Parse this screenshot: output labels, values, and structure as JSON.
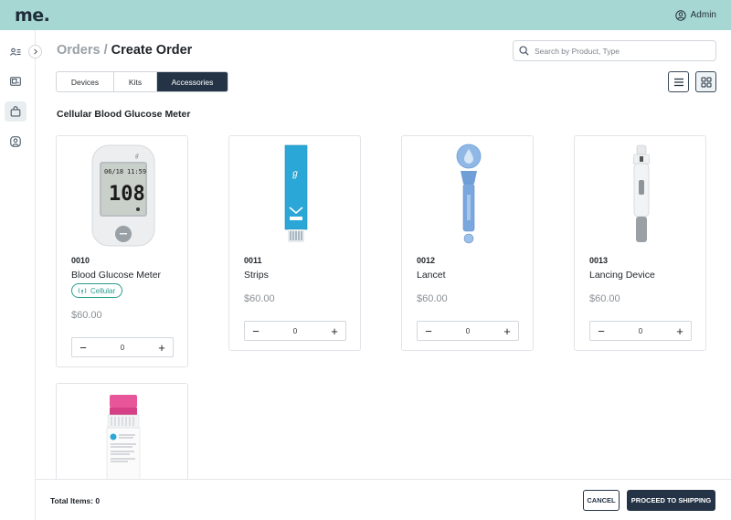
{
  "app": {
    "logo": "me.",
    "user_label": "Admin"
  },
  "sidebar": {
    "items": [
      {
        "icon": "users-list-icon"
      },
      {
        "icon": "device-icon"
      },
      {
        "icon": "shopping-bag-icon",
        "active": true
      },
      {
        "icon": "user-badge-icon"
      }
    ]
  },
  "page": {
    "breadcrumb": "Orders /",
    "title": "Create Order"
  },
  "search": {
    "placeholder": "Search by Product, Type"
  },
  "tabs": [
    {
      "label": "Devices",
      "active": false
    },
    {
      "label": "Kits",
      "active": false
    },
    {
      "label": "Accessories",
      "active": true
    }
  ],
  "view_toggle": {
    "list_icon": "list-view-icon",
    "grid_icon": "grid-view-icon",
    "selected": "grid"
  },
  "section": {
    "title": "Cellular Blood Glucose Meter"
  },
  "products": [
    {
      "sku": "0010",
      "name": "Blood Glucose Meter",
      "badge": "Cellular",
      "price": "$60.00",
      "quantity": "0",
      "meter_date": "06/18",
      "meter_time": "11:59",
      "meter_value": "108"
    },
    {
      "sku": "0011",
      "name": "Strips",
      "price": "$60.00",
      "quantity": "0"
    },
    {
      "sku": "0012",
      "name": "Lancet",
      "price": "$60.00",
      "quantity": "0"
    },
    {
      "sku": "0013",
      "name": "Lancing Device",
      "price": "$60.00",
      "quantity": "0"
    }
  ],
  "footer": {
    "total_label": "Total Items: 0",
    "cancel_label": "CANCEL",
    "proceed_label": "PROCEED TO SHIPPING"
  },
  "colors": {
    "header_bg": "#a7d7d2",
    "primary": "#243446",
    "accent": "#2a9d8f"
  }
}
